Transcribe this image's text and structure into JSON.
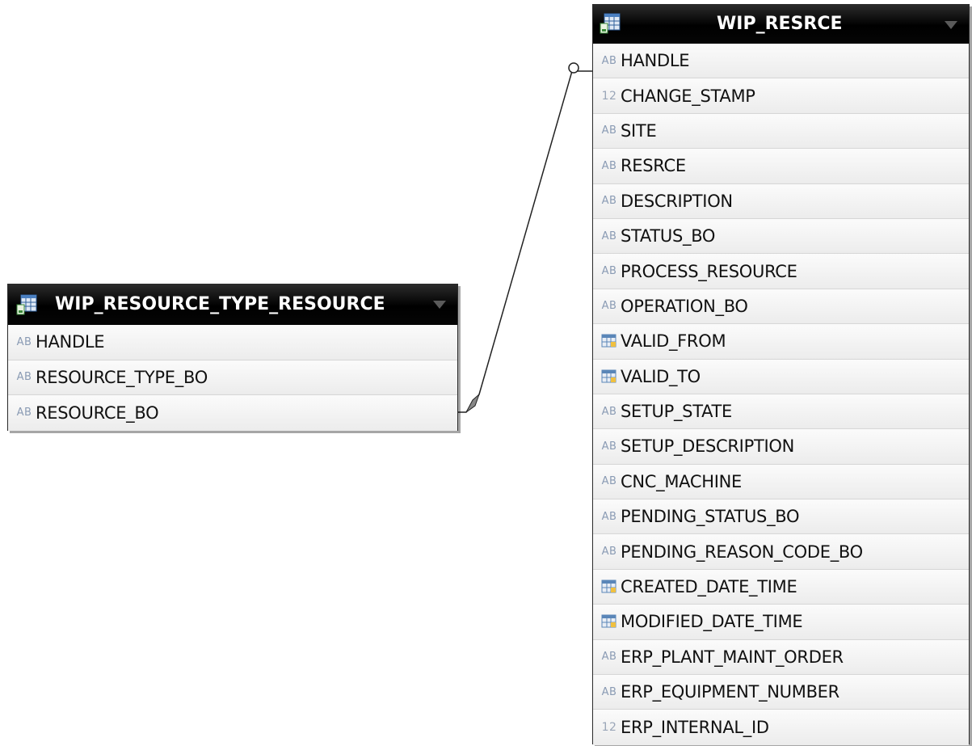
{
  "entities": {
    "left": {
      "name": "WIP_RESOURCE_TYPE_RESOURCE",
      "columns": [
        {
          "type": "AB",
          "name": "HANDLE"
        },
        {
          "type": "AB",
          "name": "RESOURCE_TYPE_BO"
        },
        {
          "type": "AB",
          "name": "RESOURCE_BO"
        }
      ]
    },
    "right": {
      "name": "WIP_RESRCE",
      "columns": [
        {
          "type": "AB",
          "name": "HANDLE"
        },
        {
          "type": "12",
          "name": "CHANGE_STAMP"
        },
        {
          "type": "AB",
          "name": "SITE"
        },
        {
          "type": "AB",
          "name": "RESRCE"
        },
        {
          "type": "AB",
          "name": "DESCRIPTION"
        },
        {
          "type": "AB",
          "name": "STATUS_BO"
        },
        {
          "type": "AB",
          "name": "PROCESS_RESOURCE"
        },
        {
          "type": "AB",
          "name": "OPERATION_BO"
        },
        {
          "type": "date",
          "name": "VALID_FROM"
        },
        {
          "type": "date",
          "name": "VALID_TO"
        },
        {
          "type": "AB",
          "name": "SETUP_STATE"
        },
        {
          "type": "AB",
          "name": "SETUP_DESCRIPTION"
        },
        {
          "type": "AB",
          "name": "CNC_MACHINE"
        },
        {
          "type": "AB",
          "name": "PENDING_STATUS_BO"
        },
        {
          "type": "AB",
          "name": "PENDING_REASON_CODE_BO"
        },
        {
          "type": "date",
          "name": "CREATED_DATE_TIME"
        },
        {
          "type": "date",
          "name": "MODIFIED_DATE_TIME"
        },
        {
          "type": "AB",
          "name": "ERP_PLANT_MAINT_ORDER"
        },
        {
          "type": "AB",
          "name": "ERP_EQUIPMENT_NUMBER"
        },
        {
          "type": "12",
          "name": "ERP_INTERNAL_ID"
        }
      ]
    }
  },
  "relationship": {
    "from_column": "RESOURCE_BO",
    "to_column": "HANDLE",
    "from_marker": "diamond",
    "to_marker": "open-circle"
  },
  "colors": {
    "header_bg": "#000000",
    "header_text": "#ffffff",
    "type_badge": "#8a9bb4",
    "row_text": "#111111"
  }
}
